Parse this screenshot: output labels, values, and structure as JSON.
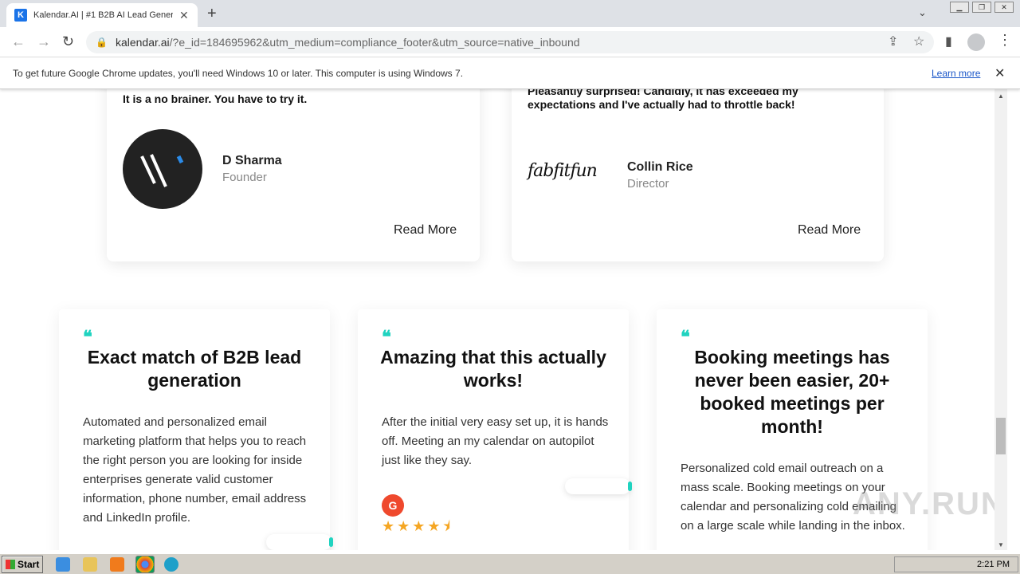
{
  "browser": {
    "tab_title": "Kalendar.AI | #1 B2B AI Lead Gener",
    "tab_favicon": "K",
    "url_host": "kalendar.ai",
    "url_path": "/?e_id=184695962&utm_medium=compliance_footer&utm_source=native_inbound"
  },
  "infobar": {
    "message": "To get future Google Chrome updates, you'll need Windows 10 or later. This computer is using Windows 7.",
    "learn_more": "Learn more"
  },
  "testimonials_top": [
    {
      "quote": "It is a no brainer. You have to try it.",
      "name": "D Sharma",
      "role": "Founder",
      "read_more": "Read More"
    },
    {
      "quote": "Pleasantly surprised! Candidly, it has exceeded my expectations and I've actually had to throttle back!",
      "logo_text": "fabfitfun",
      "name": "Collin Rice",
      "role": "Director",
      "read_more": "Read More"
    }
  ],
  "reviews": [
    {
      "heading": "Exact match of B2B lead generation",
      "body": "Automated and personalized email marketing platform that helps you to reach the right person you are looking for inside enterprises generate valid customer information, phone number, email address and LinkedIn profile."
    },
    {
      "heading": "Amazing that this actually works!",
      "body": "After the initial very easy set up, it is hands off. Meeting an my calendar on autopilot just like they say.",
      "badge": "G",
      "rating": 4.5,
      "stars": "★★★★⯨"
    },
    {
      "heading": "Booking meetings has never been easier, 20+ booked meetings per month!",
      "body": "Personalized cold email outreach on a mass scale. Booking meetings on your calendar and personalizing cold emailing on a large scale while landing in the inbox."
    }
  ],
  "watermark": "ANY.RUN",
  "taskbar": {
    "start_label": "Start",
    "clock": "2:21 PM"
  }
}
